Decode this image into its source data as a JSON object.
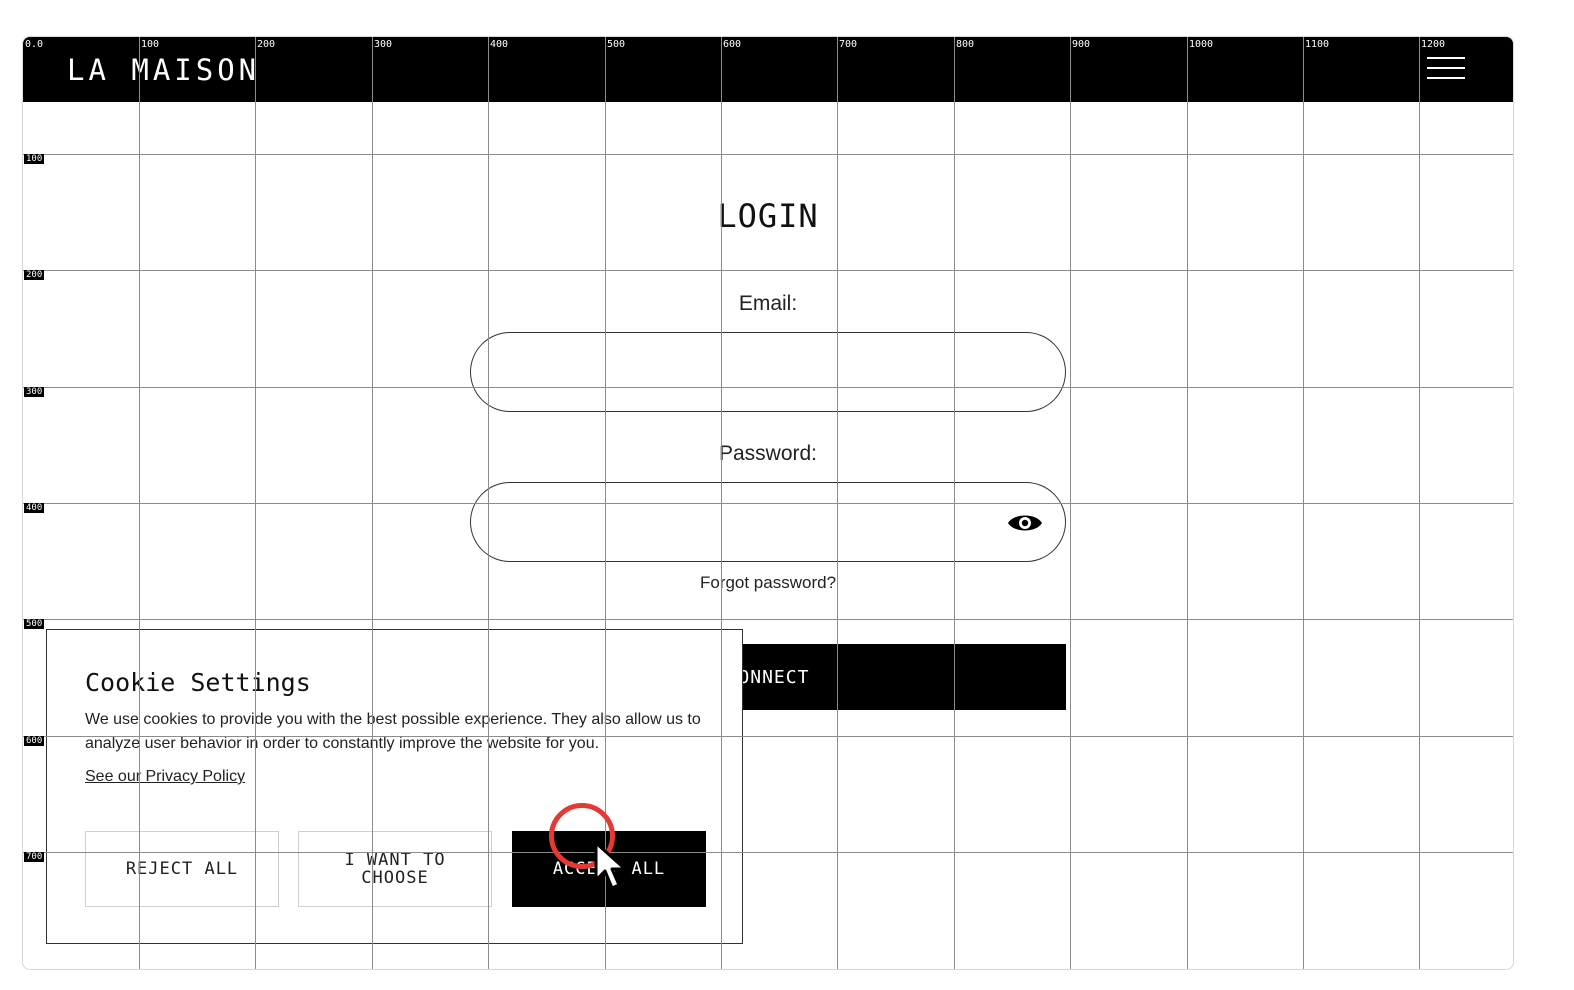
{
  "header": {
    "logo": "LA MAISON"
  },
  "grid": {
    "x_ticks": [
      "0.0",
      "100",
      "200",
      "300",
      "400",
      "500",
      "600",
      "700",
      "800",
      "900",
      "1000",
      "1100",
      "1200"
    ],
    "y_ticks": [
      "100",
      "200",
      "300",
      "400",
      "500",
      "600",
      "700"
    ]
  },
  "login": {
    "title": "LOGIN",
    "email_label": "Email:",
    "email_value": "",
    "password_label": "Password:",
    "password_value": "",
    "forgot": "Forgot password?",
    "connect": "CONNECT"
  },
  "cookie": {
    "title": "Cookie Settings",
    "text": "We use cookies to provide you with the best possible experience. They also allow us to analyze user behavior in order to constantly improve the website for you.",
    "privacy": "See our Privacy Policy",
    "reject": "REJECT ALL",
    "choose": "I WANT TO CHOOSE",
    "accept": "ACCEPT ALL"
  },
  "colors": {
    "cursor_highlight": "#e53935",
    "primary": "#000000"
  },
  "icons": {
    "menu": "hamburger-menu-icon",
    "eye": "eye-icon",
    "cursor": "mouse-pointer-icon"
  }
}
